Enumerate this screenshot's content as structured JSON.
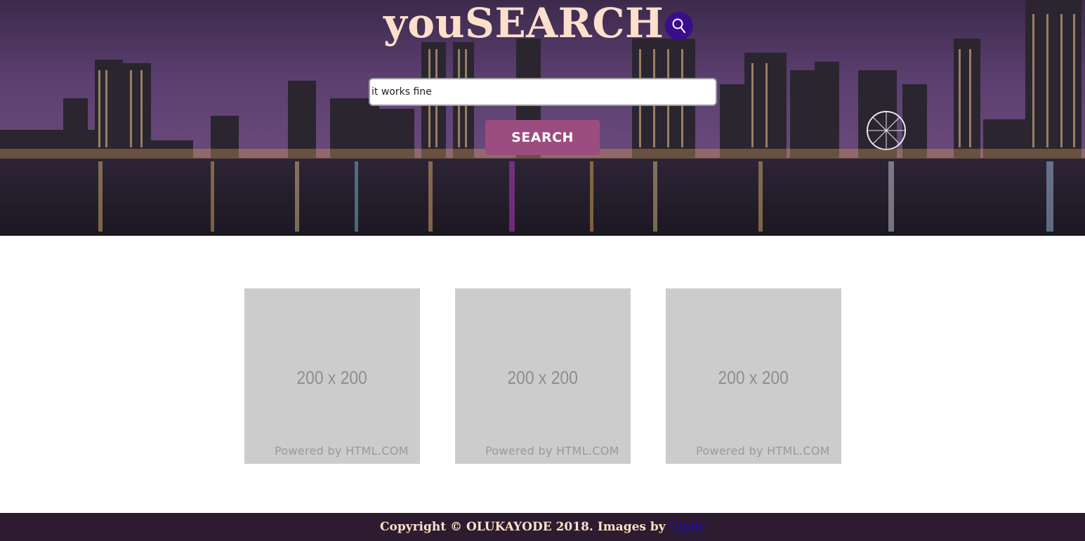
{
  "header": {
    "logo_text": "youSEARCH",
    "logo_icon": "magnifier-icon",
    "logo_icon_bg": "#3a0d8a"
  },
  "search": {
    "value": "it works fine",
    "button_label": "SEARCH",
    "button_color": "#9c4d7f"
  },
  "gallery": {
    "items": [
      {
        "size_label": "200 x 200",
        "credit": "Powered by HTML.COM"
      },
      {
        "size_label": "200 x 200",
        "credit": "Powered by HTML.COM"
      },
      {
        "size_label": "200 x 200",
        "credit": "Powered by HTML.COM"
      }
    ]
  },
  "footer": {
    "copyright": "Copyright © OLUKAYODE 2018. Images by",
    "link_text": "Giphy",
    "text_color": "#fde0cc",
    "background": "#2d1c2f"
  }
}
